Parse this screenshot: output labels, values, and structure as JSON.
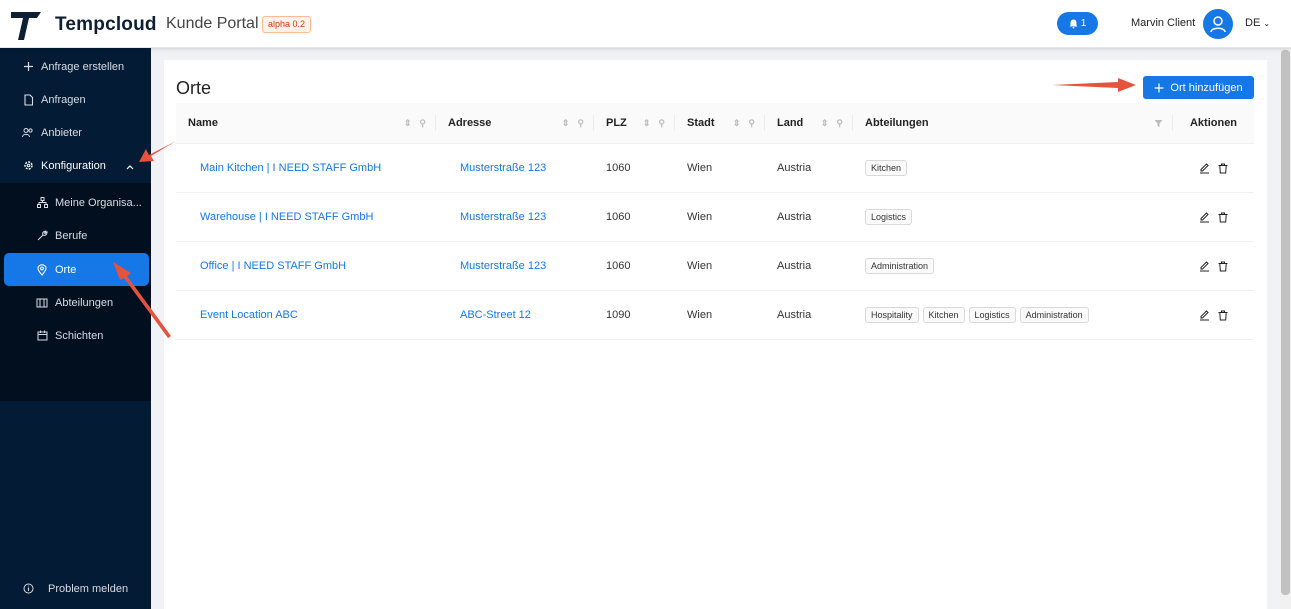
{
  "header": {
    "brand": "Tempcloud",
    "portal": "Kunde Portal",
    "badge": "alpha 0.2",
    "notifications": "1",
    "user": "Marvin Client",
    "language": "DE"
  },
  "sidebar": {
    "items": [
      {
        "label": "Anfrage erstellen",
        "icon": "plus-icon"
      },
      {
        "label": "Anfragen",
        "icon": "document-icon"
      },
      {
        "label": "Anbieter",
        "icon": "users-icon"
      },
      {
        "label": "Konfiguration",
        "icon": "gear-icon"
      }
    ],
    "subitems": [
      {
        "label": "Meine Organisa...",
        "icon": "org-icon"
      },
      {
        "label": "Berufe",
        "icon": "tool-icon"
      },
      {
        "label": "Orte",
        "icon": "location-icon"
      },
      {
        "label": "Abteilungen",
        "icon": "building-icon"
      },
      {
        "label": "Schichten",
        "icon": "calendar-icon"
      }
    ],
    "report": "Problem melden"
  },
  "page": {
    "title": "Orte",
    "add_button": "Ort hinzufügen"
  },
  "table": {
    "columns": [
      "Name",
      "Adresse",
      "PLZ",
      "Stadt",
      "Land",
      "Abteilungen",
      "Aktionen"
    ],
    "rows": [
      {
        "name": "Main Kitchen | I NEED STAFF GmbH",
        "address": "Musterstraße 123",
        "plz": "1060",
        "city": "Wien",
        "country": "Austria",
        "departments": [
          "Kitchen"
        ]
      },
      {
        "name": "Warehouse | I NEED STAFF GmbH",
        "address": "Musterstraße 123",
        "plz": "1060",
        "city": "Wien",
        "country": "Austria",
        "departments": [
          "Logistics"
        ]
      },
      {
        "name": "Office | I NEED STAFF GmbH",
        "address": "Musterstraße 123",
        "plz": "1060",
        "city": "Wien",
        "country": "Austria",
        "departments": [
          "Administration"
        ]
      },
      {
        "name": "Event Location ABC",
        "address": "ABC-Street 12",
        "plz": "1090",
        "city": "Wien",
        "country": "Austria",
        "departments": [
          "Hospitality",
          "Kitchen",
          "Logistics",
          "Administration"
        ]
      }
    ]
  },
  "colors": {
    "primary": "#1677e6",
    "sidebar": "#031b35",
    "annotation": "#e5533c"
  }
}
